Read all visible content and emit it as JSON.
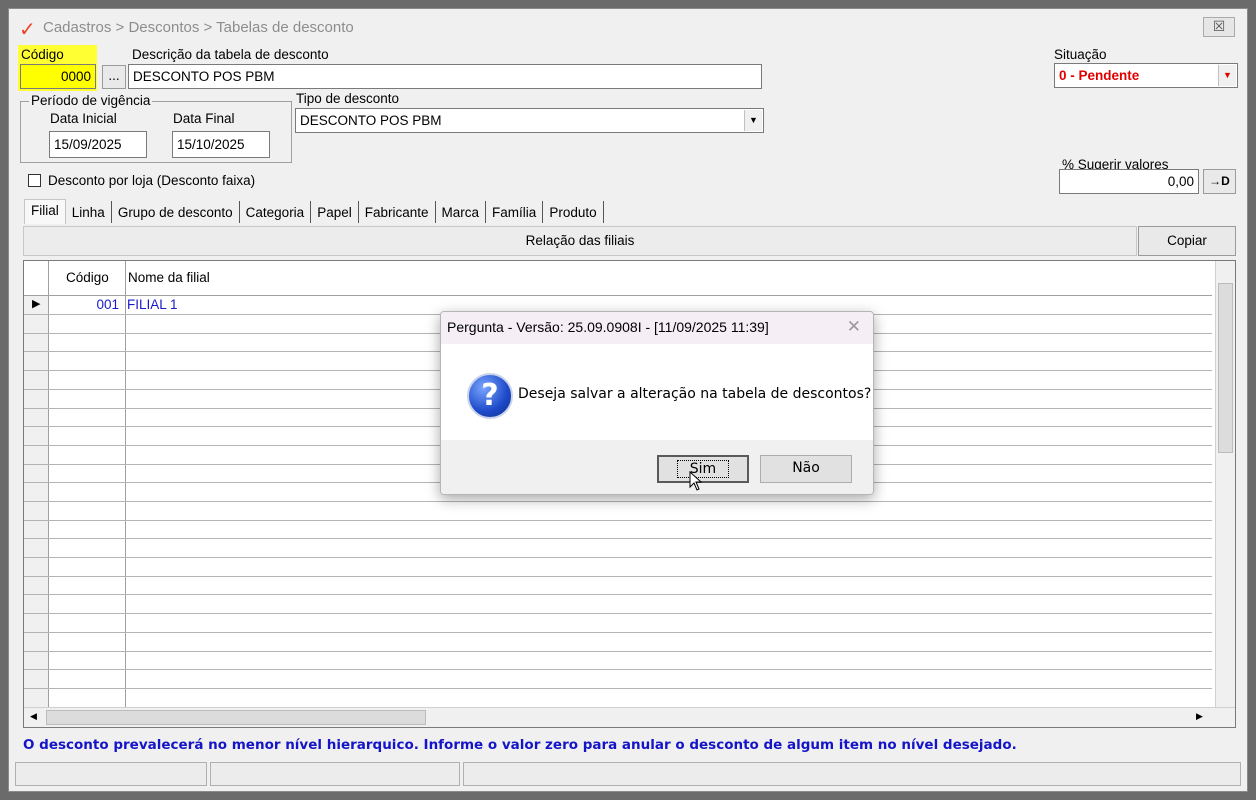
{
  "window": {
    "title": "Cadastros > Descontos > Tabelas de desconto",
    "close_label": "☒"
  },
  "form": {
    "codigo_label": "Código",
    "codigo_value": "0000",
    "lookup_label": "...",
    "descricao_label": "Descrição da tabela de desconto",
    "descricao_value": "DESCONTO POS PBM",
    "situacao_label": "Situação",
    "situacao_value": "0 - Pendente",
    "situacao_color": "#e00000",
    "periodo_label": "Período de vigência",
    "data_inicial_label": "Data Inicial",
    "data_inicial_value": "15/09/2025",
    "data_final_label": "Data Final",
    "data_final_value": "15/10/2025",
    "tipo_label": "Tipo de desconto",
    "tipo_value": "DESCONTO POS PBM",
    "desconto_loja_label": "Desconto por loja (Desconto faixa)",
    "sugerir_label": "% Sugerir valores",
    "sugerir_value": "0,00",
    "apply_icon": "→D"
  },
  "tabs": [
    "Filial",
    "Linha",
    "Grupo de desconto",
    "Categoria",
    "Papel",
    "Fabricante",
    "Marca",
    "Família",
    "Produto"
  ],
  "grid": {
    "title": "Relação das filiais",
    "copiar_label": "Copiar",
    "columns": [
      "Código",
      "Nome da filial"
    ],
    "rows": [
      {
        "codigo": "001",
        "nome": "FILIAL 1"
      }
    ]
  },
  "info_text": "O desconto prevalecerá no menor nível hierarquico. Informe o valor zero para anular o desconto de algum item no nível desejado.",
  "dialog": {
    "title": "Pergunta - Versão: 25.09.0908I - [11/09/2025 11:39]",
    "message": "Deseja salvar a alteração na tabela de descontos?",
    "yes_label": "Sim",
    "no_label": "Não"
  }
}
